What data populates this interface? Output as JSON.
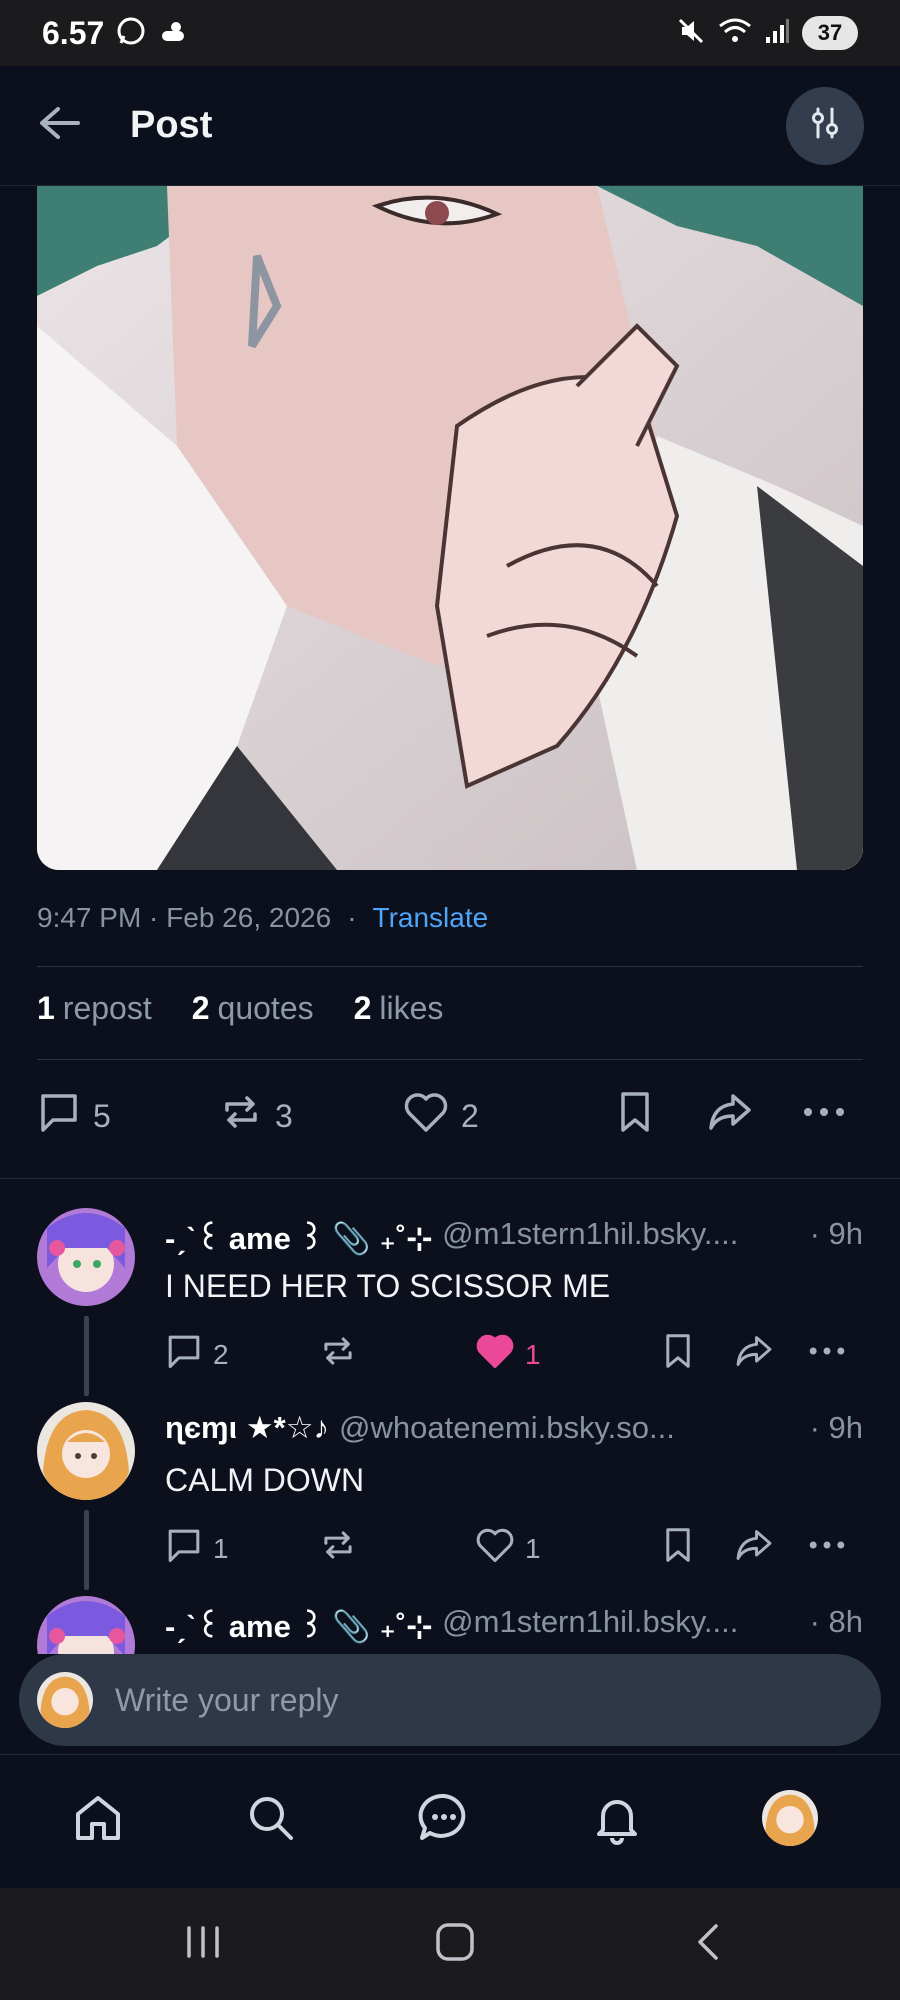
{
  "status_bar": {
    "time": "6.57",
    "battery": "37"
  },
  "header": {
    "title": "Post"
  },
  "post": {
    "time": "9:47 PM · Feb 26, 2026",
    "separator": "·",
    "translate_label": "Translate",
    "stats": {
      "reposts_count": "1",
      "reposts_label": "repost",
      "quotes_count": "2",
      "quotes_label": "quotes",
      "likes_count": "2",
      "likes_label": "likes"
    },
    "actions": {
      "replies": "5",
      "reposts": "3",
      "likes": "2"
    }
  },
  "replies": [
    {
      "name": "-ˏˋ꒰ ame ꒱ 📎 ₊˚⊹",
      "handle": "@m1stern1hil.bsky....",
      "time": "· 9h",
      "text": "I NEED HER TO SCISSOR ME",
      "reply_count": "2",
      "repost_count": "",
      "like_count": "1",
      "liked": true
    },
    {
      "name": "ɳєɱι ★*☆♪",
      "handle": "@whoatenemi.bsky.so...",
      "time": "· 9h",
      "text": "CALM DOWN",
      "reply_count": "1",
      "repost_count": "",
      "like_count": "1",
      "liked": false
    },
    {
      "name": "-ˏˋ꒰ ame ꒱ 📎 ₊˚⊹",
      "handle": "@m1stern1hil.bsky....",
      "time": "· 8h"
    }
  ],
  "composer": {
    "placeholder": "Write your reply"
  },
  "colors": {
    "background": "#0b101c",
    "accent": "#4ea4f6",
    "like": "#ec4899"
  }
}
